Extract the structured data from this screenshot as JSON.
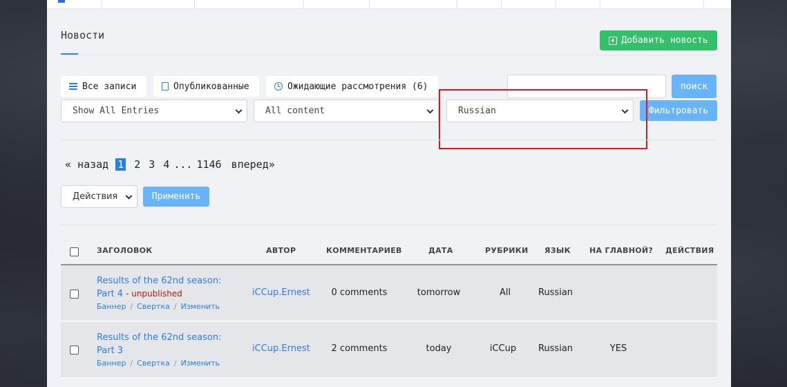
{
  "page": {
    "title": "Новости",
    "add_button": "Добавить новость"
  },
  "tabs": [
    {
      "label": "Все записи"
    },
    {
      "label": "Опубликованные"
    },
    {
      "label": "Ожидающие рассмотрения (6)"
    }
  ],
  "search": {
    "value": "",
    "button": "поиск"
  },
  "filters": {
    "entries": "Show All Entries",
    "content": "All content",
    "language": "Russian",
    "button": "Фильтровать"
  },
  "pagination": {
    "prev": "« назад",
    "current": "1",
    "pages": [
      "2",
      "3",
      "4"
    ],
    "ellipsis": "...",
    "last": "1146",
    "next": "вперед»"
  },
  "bulk": {
    "select": "Действия",
    "apply": "Применить"
  },
  "table": {
    "headers": [
      "ЗАГОЛОВОК",
      "АВТОР",
      "КОММЕНТАРИЕВ",
      "ДАТА",
      "РУБРИКИ",
      "ЯЗЫК",
      "НА ГЛАВНОЙ?",
      "ДЕЙСТВИЯ"
    ],
    "rows": [
      {
        "title": "Results of the 62nd season: Part 4",
        "status": "- unpublished",
        "links": [
          "Баннер",
          "Свертка",
          "Изменить"
        ],
        "author": "iCCup.Ernest",
        "comments": "0 comments",
        "date": "tomorrow",
        "category": "All",
        "language": "Russian",
        "frontpage": ""
      },
      {
        "title": "Results of the 62nd season: Part 3",
        "status": "",
        "links": [
          "Баннер",
          "Свертка",
          "Изменить"
        ],
        "author": "iCCup.Ernest",
        "comments": "2 comments",
        "date": "today",
        "category": "iCCup",
        "language": "Russian",
        "frontpage": "YES"
      }
    ]
  },
  "colors": {
    "accent": "#2a7de1",
    "add_green": "#34c06a",
    "button_blue": "#69b4f9",
    "highlight_red": "#d71920",
    "unpublished_red": "#b01818"
  }
}
